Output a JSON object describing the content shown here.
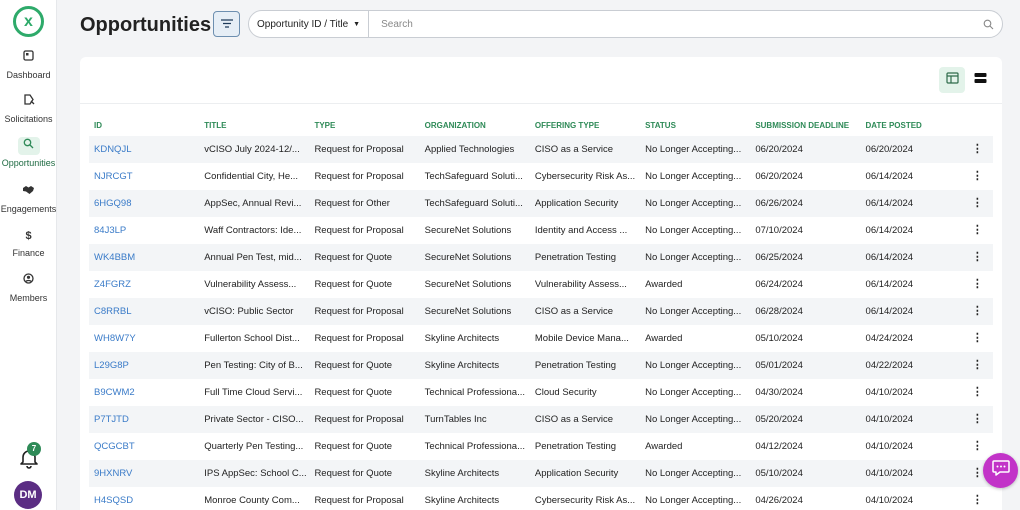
{
  "sidebar": {
    "items": [
      {
        "label": "Dashboard",
        "icon": "dashboard-icon"
      },
      {
        "label": "Solicitations",
        "icon": "solicitations-icon"
      },
      {
        "label": "Opportunities",
        "icon": "search-icon"
      },
      {
        "label": "Engagements",
        "icon": "handshake-icon"
      },
      {
        "label": "Finance",
        "icon": "dollar-icon"
      },
      {
        "label": "Members",
        "icon": "members-icon"
      }
    ],
    "notification_count": "7",
    "avatar_initials": "DM"
  },
  "header": {
    "title": "Opportunities",
    "search_field": "Opportunity ID / Title",
    "search_placeholder": "Search"
  },
  "table": {
    "columns": [
      "ID",
      "TITLE",
      "TYPE",
      "ORGANIZATION",
      "OFFERING TYPE",
      "STATUS",
      "SUBMISSION DEADLINE",
      "DATE POSTED"
    ],
    "rows": [
      [
        "KDNQJL",
        "vCISO July 2024-12/...",
        "Request for Proposal",
        "Applied Technologies",
        "CISO as a Service",
        "No Longer Accepting...",
        "06/20/2024",
        "06/20/2024"
      ],
      [
        "NJRCGT",
        "Confidential City, He...",
        "Request for Proposal",
        "TechSafeguard Soluti...",
        "Cybersecurity Risk As...",
        "No Longer Accepting...",
        "06/20/2024",
        "06/14/2024"
      ],
      [
        "6HGQ98",
        "AppSec, Annual Revi...",
        "Request for Other",
        "TechSafeguard Soluti...",
        "Application Security",
        "No Longer Accepting...",
        "06/26/2024",
        "06/14/2024"
      ],
      [
        "84J3LP",
        "Waff Contractors: Ide...",
        "Request for Proposal",
        "SecureNet Solutions",
        "Identity and Access ...",
        "No Longer Accepting...",
        "07/10/2024",
        "06/14/2024"
      ],
      [
        "WK4BBM",
        "Annual Pen Test, mid...",
        "Request for Quote",
        "SecureNet Solutions",
        "Penetration Testing",
        "No Longer Accepting...",
        "06/25/2024",
        "06/14/2024"
      ],
      [
        "Z4FGRZ",
        "Vulnerability Assess...",
        "Request for Quote",
        "SecureNet Solutions",
        "Vulnerability Assess...",
        "Awarded",
        "06/24/2024",
        "06/14/2024"
      ],
      [
        "C8RRBL",
        "vCISO: Public Sector",
        "Request for Proposal",
        "SecureNet Solutions",
        "CISO as a Service",
        "No Longer Accepting...",
        "06/28/2024",
        "06/14/2024"
      ],
      [
        "WH8W7Y",
        "Fullerton School Dist...",
        "Request for Proposal",
        "Skyline Architects",
        "Mobile Device Mana...",
        "Awarded",
        "05/10/2024",
        "04/24/2024"
      ],
      [
        "L29G8P",
        "Pen Testing: City of B...",
        "Request for Quote",
        "Skyline Architects",
        "Penetration Testing",
        "No Longer Accepting...",
        "05/01/2024",
        "04/22/2024"
      ],
      [
        "B9CWM2",
        "Full Time Cloud Servi...",
        "Request for Quote",
        "Technical Professiona...",
        "Cloud Security",
        "No Longer Accepting...",
        "04/30/2024",
        "04/10/2024"
      ],
      [
        "P7TJTD",
        "Private Sector - CISO...",
        "Request for Proposal",
        "TurnTables Inc",
        "CISO as a Service",
        "No Longer Accepting...",
        "05/20/2024",
        "04/10/2024"
      ],
      [
        "QCGCBT",
        "Quarterly Pen Testing...",
        "Request for Quote",
        "Technical Professiona...",
        "Penetration Testing",
        "Awarded",
        "04/12/2024",
        "04/10/2024"
      ],
      [
        "9HXNRV",
        "IPS AppSec: School C...",
        "Request for Quote",
        "Skyline Architects",
        "Application Security",
        "No Longer Accepting...",
        "05/10/2024",
        "04/10/2024"
      ],
      [
        "H4SQSD",
        "Monroe County Com...",
        "Request for Proposal",
        "Skyline Architects",
        "Cybersecurity Risk As...",
        "No Longer Accepting...",
        "04/26/2024",
        "04/10/2024"
      ]
    ]
  },
  "colors": {
    "accent": "#2e8a57",
    "link": "#3a7bc8",
    "avatar": "#5b2d83",
    "chat": "#c233c8"
  }
}
